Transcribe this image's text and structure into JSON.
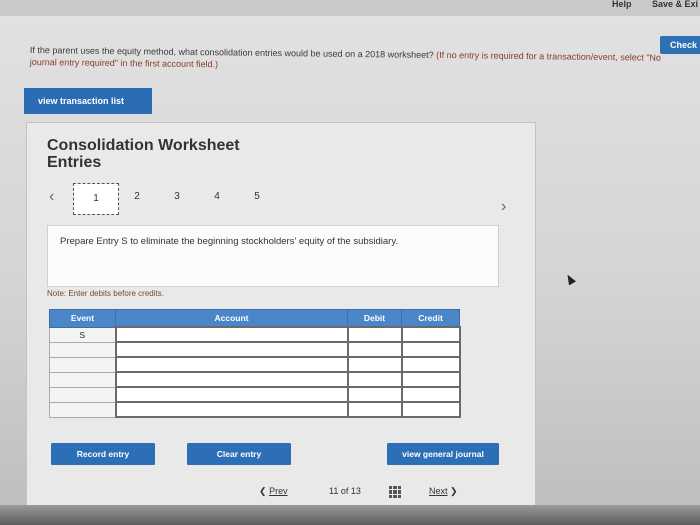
{
  "topbar": {
    "help": "Help",
    "save_exit": "Save & Exi"
  },
  "check_label": "Check",
  "question": {
    "text": "If the parent uses the equity method, what consolidation entries would be used on a 2018 worksheet?",
    "instruction": "(If no entry is required for a transaction/event, select \"No journal entry required\" in the first account field.)"
  },
  "view_transaction_list": "view transaction list",
  "panel": {
    "title": "Consolidation Worksheet Entries",
    "steps": [
      "1",
      "2",
      "3",
      "4",
      "5"
    ],
    "active_step": "1",
    "prompt": "Prepare Entry S to eliminate the beginning stockholders' equity of the subsidiary.",
    "note": "Note: Enter debits before credits."
  },
  "table": {
    "headers": {
      "event": "Event",
      "account": "Account",
      "debit": "Debit",
      "credit": "Credit"
    },
    "rows": [
      {
        "event": "S",
        "account": "",
        "debit": "",
        "credit": ""
      },
      {
        "event": "",
        "account": "",
        "debit": "",
        "credit": ""
      },
      {
        "event": "",
        "account": "",
        "debit": "",
        "credit": ""
      },
      {
        "event": "",
        "account": "",
        "debit": "",
        "credit": ""
      },
      {
        "event": "",
        "account": "",
        "debit": "",
        "credit": ""
      },
      {
        "event": "",
        "account": "",
        "debit": "",
        "credit": ""
      }
    ]
  },
  "buttons": {
    "record_entry": "Record entry",
    "clear_entry": "Clear entry",
    "view_general_journal": "view general journal"
  },
  "pager": {
    "prev": "Prev",
    "position": "11 of 13",
    "next": "Next"
  },
  "colors": {
    "accent": "#2d6fb6",
    "header": "#4a86c8"
  },
  "icons": [
    "chevron-left-icon",
    "chevron-right-icon",
    "grid-icon",
    "prev-arrow-icon",
    "next-arrow-icon"
  ]
}
